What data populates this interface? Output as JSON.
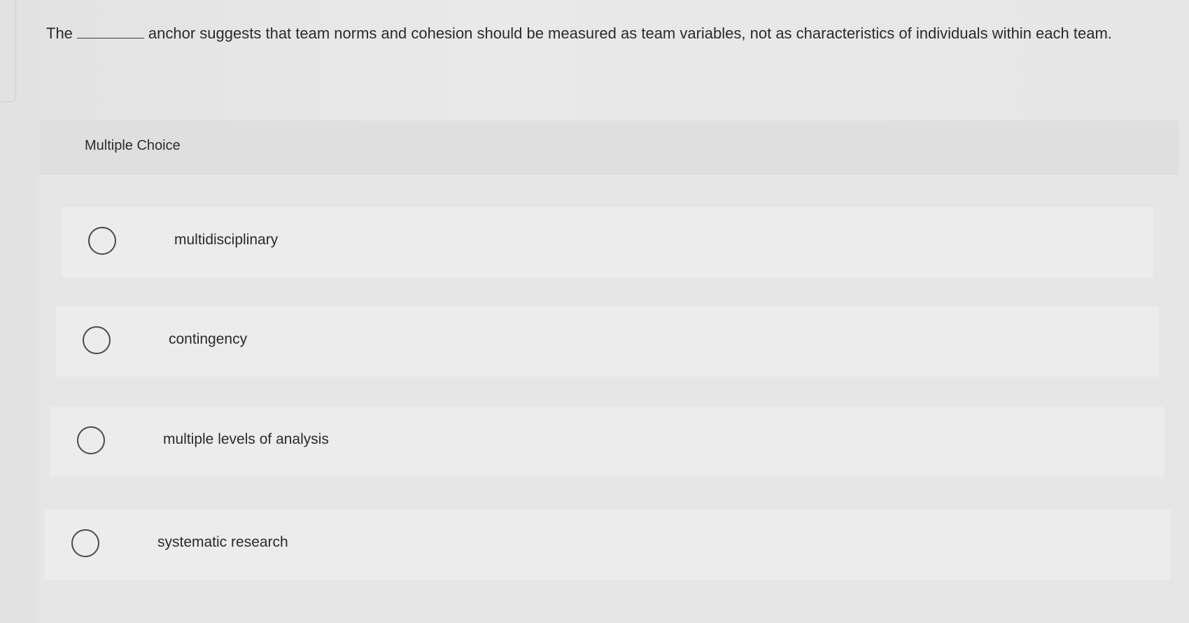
{
  "question": {
    "prefix": "The",
    "suffix": "anchor suggests that team norms and cohesion should be measured as team variables, not as characteristics of individuals within each team."
  },
  "mc": {
    "title": "Multiple Choice",
    "options": [
      {
        "label": "multidisciplinary"
      },
      {
        "label": "contingency"
      },
      {
        "label": "multiple levels of analysis"
      },
      {
        "label": "systematic research"
      }
    ]
  }
}
